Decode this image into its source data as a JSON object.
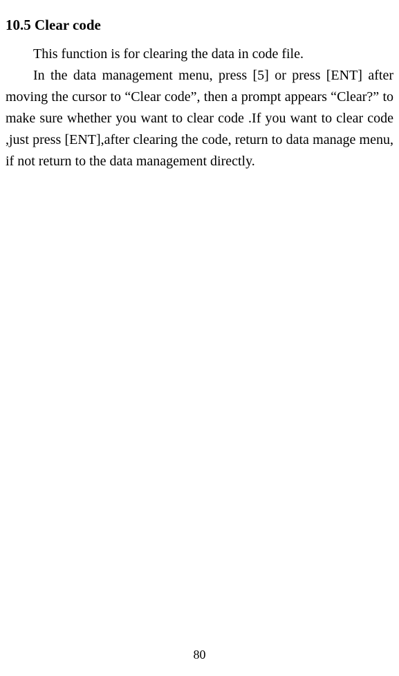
{
  "heading": "10.5 Clear code",
  "paragraphs": [
    "This function is for clearing the data in code file.",
    "In the data management menu, press [5] or press [ENT] after moving the cursor to “Clear code”, then    a prompt appears “Clear?” to make sure whether you want to clear code .If you want to clear code ,just press [ENT],after clearing the code, return to data manage menu, if not return to the data management directly."
  ],
  "page_number": "80"
}
